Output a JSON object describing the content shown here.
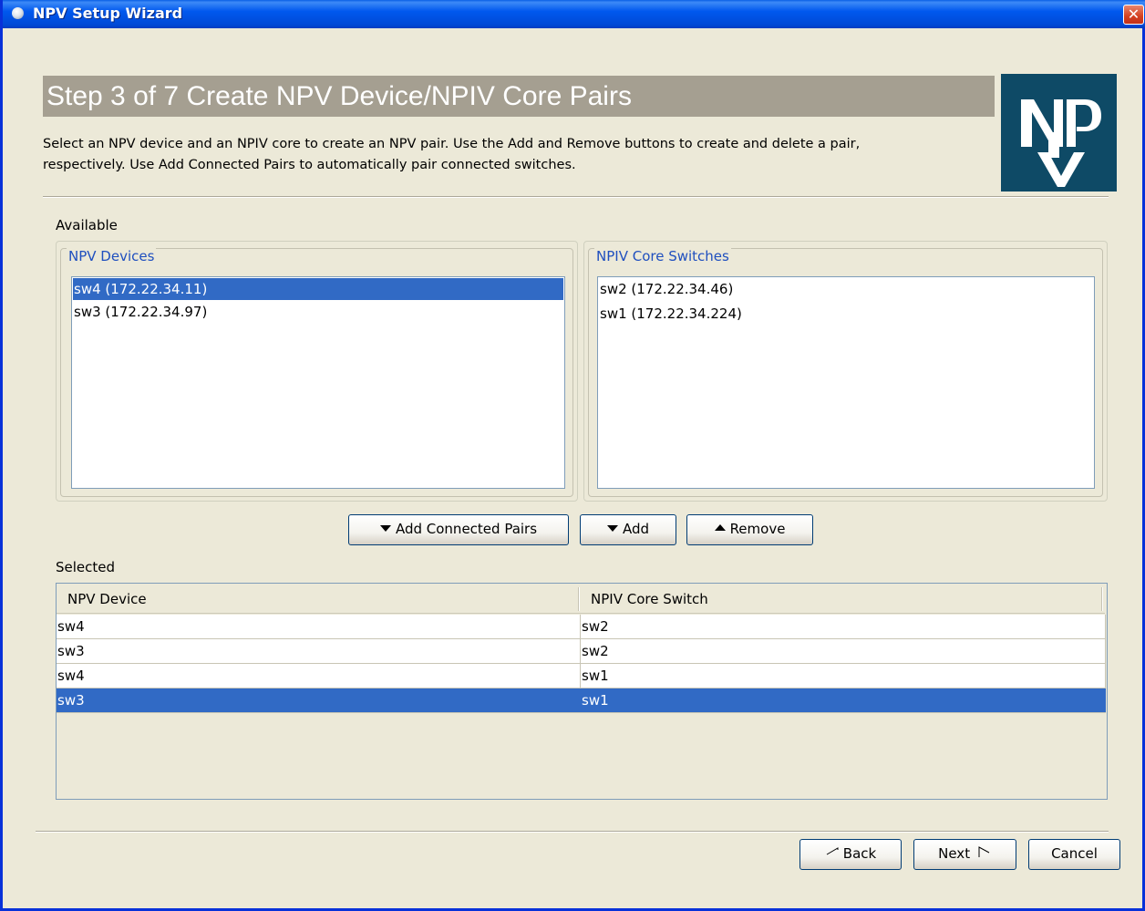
{
  "window": {
    "title": "NPV Setup Wizard",
    "close_glyph": "✕"
  },
  "header": {
    "step_title": "Step 3 of 7 Create NPV Device/NPIV Core Pairs",
    "description_line1": "Select an NPV device and an NPIV core to create an NPV pair.  Use the Add and Remove buttons to create and delete a pair,",
    "description_line2": "respectively.  Use Add Connected Pairs to automatically pair connected switches.",
    "logo_icon": "npv-logo"
  },
  "available": {
    "label": "Available",
    "npv_devices": {
      "title": "NPV Devices",
      "items": [
        "sw4 (172.22.34.11)",
        "sw3 (172.22.34.97)"
      ],
      "selected_index": 0
    },
    "npiv_core_switches": {
      "title": "NPIV Core Switches",
      "items": [
        "sw2 (172.22.34.46)",
        "sw1 (172.22.34.224)"
      ]
    }
  },
  "actions": {
    "add_connected_pairs": "Add Connected Pairs",
    "add": "Add",
    "remove": "Remove"
  },
  "selected": {
    "label": "Selected",
    "columns": [
      "NPV Device",
      "NPIV Core Switch"
    ],
    "rows": [
      [
        "sw4",
        "sw2"
      ],
      [
        "sw3",
        "sw2"
      ],
      [
        "sw4",
        "sw1"
      ],
      [
        "sw3",
        "sw1"
      ]
    ],
    "selected_row": 3
  },
  "footer": {
    "back": "Back",
    "next": "Next",
    "cancel": "Cancel"
  },
  "colors": {
    "selection": "#316ac5",
    "title_bar": "#0058ee",
    "step_banner": "#a59f91",
    "logo_bg": "#0e4a66",
    "legend_text": "#1f4fbf"
  }
}
